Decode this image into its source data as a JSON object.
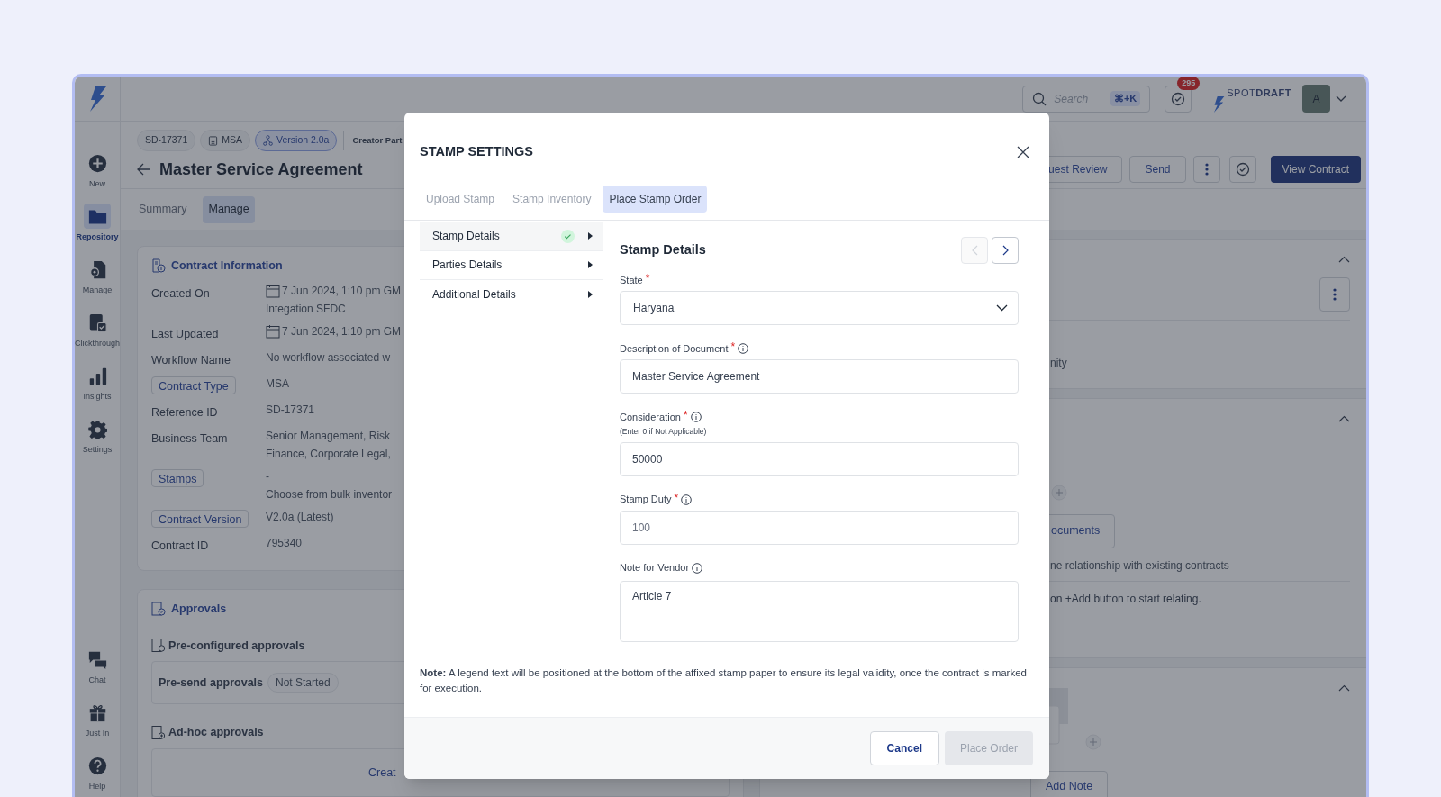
{
  "sidebar": {
    "items": [
      {
        "label": "New",
        "selected": false
      },
      {
        "label": "Repository",
        "selected": true
      },
      {
        "label": "Manage",
        "selected": false
      },
      {
        "label": "Clickthrough",
        "selected": false
      },
      {
        "label": "Insights",
        "selected": false
      },
      {
        "label": "Settings",
        "selected": false
      }
    ],
    "bottom_items": [
      {
        "label": "Chat",
        "selected": false
      },
      {
        "label": "Just In",
        "selected": false
      },
      {
        "label": "Help",
        "selected": false
      }
    ]
  },
  "header": {
    "search": {
      "placeholder": "Search",
      "shortcut": "⌘+K"
    },
    "notifications": {
      "count": "295"
    },
    "brand": "SPOT**DRAFT**",
    "avatar": "A"
  },
  "contract": {
    "pills": [
      {
        "kind": "id",
        "label": "SD-17371",
        "selected": false
      },
      {
        "kind": "document",
        "label": "MSA",
        "selected": false
      },
      {
        "kind": "version",
        "label": "Version 2.0a",
        "selected": true
      }
    ],
    "creator": "Creator Part",
    "title": "Master Service Agreement",
    "actions": [
      {
        "kind": "text",
        "label": "uest Review"
      },
      {
        "kind": "text",
        "label": "Send"
      },
      {
        "kind": "more"
      },
      {
        "kind": "check"
      },
      {
        "kind": "primary",
        "label": "View Contract"
      }
    ],
    "tabs": [
      {
        "label": "Summary",
        "selected": false
      },
      {
        "label": "Manage",
        "selected": true
      }
    ]
  },
  "contract_info": {
    "title": "Contract Information",
    "rows": [
      {
        "label": "Created On",
        "kind": "plain",
        "values": [
          {
            "text": "7 Jun 2024, 1:10 pm GM",
            "date": true
          },
          {
            "text": "Integation SFDC",
            "date": false
          }
        ]
      },
      {
        "label": "Last Updated",
        "kind": "plain",
        "values": [
          {
            "text": "7 Jun 2024, 1:10 pm GM",
            "date": true
          }
        ]
      },
      {
        "label": "Workflow Name",
        "kind": "plain",
        "values": [
          {
            "text": "No workflow associated w",
            "date": false
          }
        ]
      },
      {
        "label": "Contract Type",
        "kind": "tag",
        "values": [
          {
            "text": "MSA",
            "date": false
          }
        ]
      },
      {
        "label": "Reference ID",
        "kind": "plain",
        "values": [
          {
            "text": "SD-17371",
            "date": false
          }
        ]
      },
      {
        "label": "Business Team",
        "kind": "plain",
        "values": [
          {
            "text": "Senior Management, Risk",
            "date": false
          },
          {
            "text": "Finance, Corporate Legal,",
            "date": false
          }
        ]
      },
      {
        "label": "Stamps",
        "kind": "tag",
        "values": [
          {
            "text": "-",
            "date": false
          },
          {
            "text": "Choose from bulk inventor",
            "date": false
          }
        ]
      },
      {
        "label": "Contract Version",
        "kind": "tag",
        "values": [
          {
            "text": "V2.0a (Latest)",
            "date": false
          }
        ]
      },
      {
        "label": "Contract ID",
        "kind": "plain",
        "values": [
          {
            "text": "795340",
            "date": false
          }
        ]
      }
    ]
  },
  "approvals": {
    "title": "Approvals",
    "preconfigured": {
      "title": "Pre-configured approvals",
      "row": {
        "label": "Pre-send approvals",
        "status": "Not Started"
      }
    },
    "adhoc": {
      "title": "Ad-hoc approvals",
      "button": "Creat"
    }
  },
  "right_panel": {
    "sections": [
      {
        "kind": "info",
        "texts": [
          "nity"
        ]
      },
      {
        "kind": "related",
        "button": "ocuments",
        "texts": [
          "ne relationship with existing contracts",
          "on +Add button to start relating."
        ]
      },
      {
        "kind": "notes",
        "button": "Add Note"
      }
    ]
  },
  "modal": {
    "title": "STAMP SETTINGS",
    "tabs": [
      {
        "label": "Upload Stamp",
        "selected": false
      },
      {
        "label": "Stamp Inventory",
        "selected": false
      },
      {
        "label": "Place Stamp Order",
        "selected": true
      }
    ],
    "steps": [
      {
        "label": "Stamp Details",
        "done": true,
        "selected": true
      },
      {
        "label": "Parties Details",
        "done": false,
        "selected": false
      },
      {
        "label": "Additional Details",
        "done": false,
        "selected": false
      }
    ],
    "heading": "Stamp Details",
    "nav_buttons": [
      {
        "disabled": true
      },
      {
        "disabled": false
      }
    ],
    "fields": [
      {
        "kind": "select",
        "label": "State",
        "required_mark": "*",
        "info": false,
        "value": "Haryana",
        "disabled": false
      },
      {
        "kind": "text",
        "label": "Description of Document",
        "required_mark": "*",
        "info": true,
        "value": "Master Service Agreement",
        "disabled": false
      },
      {
        "kind": "text",
        "label": "Consideration",
        "required_mark": "*",
        "info": true,
        "hint": "(Enter 0 if Not Applicable)",
        "value": "50000",
        "disabled": false
      },
      {
        "kind": "text",
        "label": "Stamp Duty",
        "required_mark": "*",
        "info": true,
        "value": "100",
        "disabled": true
      },
      {
        "kind": "textarea",
        "label": "Note for Vendor",
        "info": true,
        "value": "Article 7",
        "disabled": false
      }
    ],
    "note": "**Note:** A legend text will be positioned at the bottom of the affixed stamp paper to ensure its legal validity, once the contract is marked for execution.",
    "buttons": [
      {
        "label": "Cancel",
        "disabled": false
      },
      {
        "label": "Place Order",
        "disabled": true
      }
    ]
  }
}
